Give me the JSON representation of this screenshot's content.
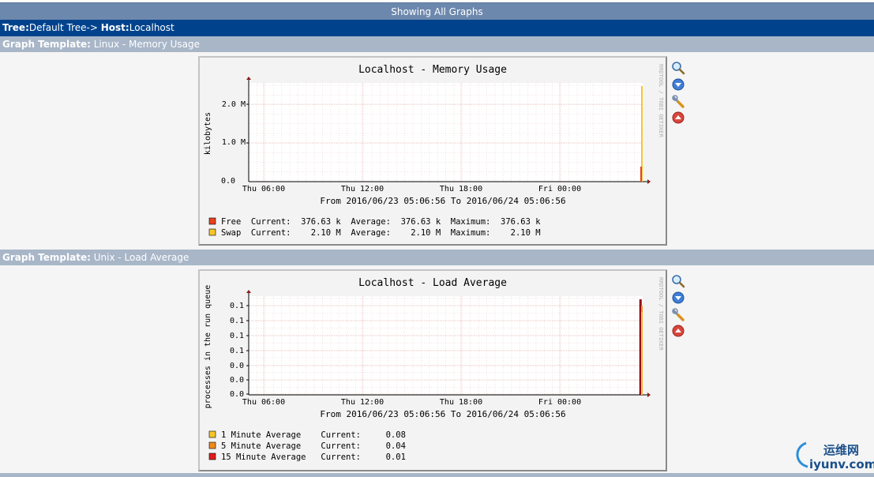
{
  "header": {
    "title": "Showing All Graphs"
  },
  "breadcrumb": {
    "tree_label": "Tree:",
    "tree_value": "Default Tree->",
    "host_label": "Host:",
    "host_value": "Localhost"
  },
  "sections": [
    {
      "template_label": "Graph Template:",
      "template_name": "Linux - Memory Usage",
      "graph": {
        "title": "Localhost - Memory Usage",
        "ylabel": "kilobytes",
        "yticks": [
          "2.0 M",
          "1.0 M",
          "0.0"
        ],
        "xticks": [
          "Thu 06:00",
          "Thu 12:00",
          "Thu 18:00",
          "Fri 00:00"
        ],
        "range": "From 2016/06/23 05:06:56 To 2016/06/24 05:06:56",
        "watermark": "RRDTOOL / TOBI OETIKER",
        "legend": [
          {
            "color": "#e8421c",
            "text": "Free  Current:  376.63 k  Average:  376.63 k  Maximum:  376.63 k"
          },
          {
            "color": "#f7c52b",
            "text": "Swap  Current:    2.10 M  Average:    2.10 M  Maximum:    2.10 M"
          }
        ]
      }
    },
    {
      "template_label": "Graph Template:",
      "template_name": "Unix - Load Average",
      "graph": {
        "title": "Localhost - Load Average",
        "ylabel": "processes in the run queue",
        "yticks": [
          "0.1",
          "0.1",
          "0.1",
          "0.1",
          "0.0",
          "0.0",
          "0.0"
        ],
        "xticks": [
          "Thu 06:00",
          "Thu 12:00",
          "Thu 18:00",
          "Fri 00:00"
        ],
        "range": "From 2016/06/23 05:06:56 To 2016/06/24 05:06:56",
        "watermark": "RRDTOOL / TOBI OETIKER",
        "legend": [
          {
            "color": "#f7c52b",
            "text": "1 Minute Average    Current:     0.08"
          },
          {
            "color": "#f08a1c",
            "text": "5 Minute Average    Current:     0.04"
          },
          {
            "color": "#e01c1c",
            "text": "15 Minute Average   Current:     0.01"
          }
        ]
      }
    }
  ],
  "icons": [
    "zoom-icon",
    "properties-icon",
    "wrench-icon",
    "back-to-top-icon"
  ],
  "watermark_site": {
    "cn": "运维网",
    "url": "iyunv.com"
  }
}
